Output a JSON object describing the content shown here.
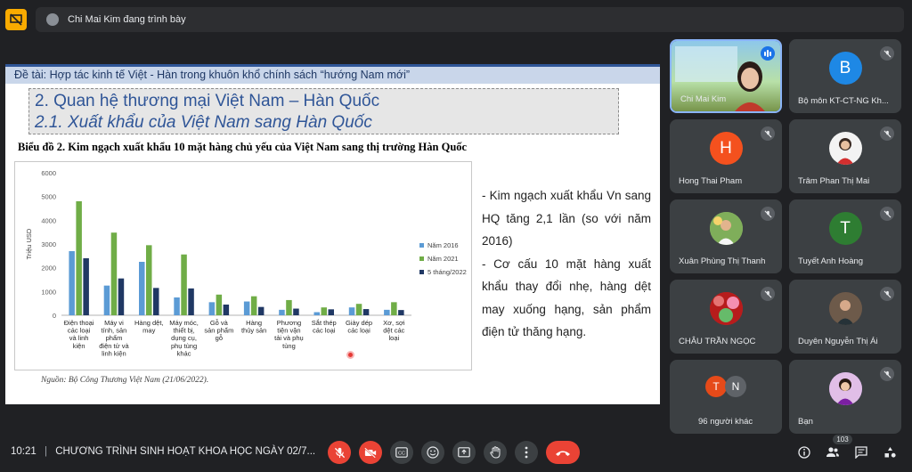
{
  "top_bar": {
    "presenter_text": "Chi Mai Kim đang trình bày"
  },
  "slide": {
    "topic": "Đề tài: Hợp tác kinh tế  Việt - Hàn trong khuôn khổ chính sách “hướng Nam mới”",
    "heading1": "2. Quan hệ thương mại Việt Nam – Hàn Quốc",
    "heading2": "2.1. Xuất khẩu của Việt Nam sang Hàn Quốc",
    "chart_title": "Biểu đồ 2. Kim ngạch xuất khẩu 10 mặt hàng chủ yếu của Việt Nam sang thị trường Hàn Quốc",
    "source": "Nguồn: Bộ Công Thương Việt Nam (21/06/2022).",
    "bullet1": "- Kim ngạch xuất khẩu Vn sang HQ tăng 2,1 lần (so với năm 2016)",
    "bullet2": "-  Cơ cấu 10 mặt hàng xuất khẩu thay đổi nhẹ, hàng dệt may xuống hạng, sản phẩm điện tử thăng hạng."
  },
  "chart_data": {
    "type": "bar",
    "ylabel": "Triệu USD",
    "ylim": [
      0,
      6000
    ],
    "yticks": [
      0,
      1000,
      2000,
      3000,
      4000,
      5000,
      6000
    ],
    "legend_position": "right",
    "categories": [
      [
        "Điện thoại",
        "các loại",
        "và linh",
        "kiện"
      ],
      [
        "Máy vi",
        "tính, sản",
        "phẩm",
        "điện tử và",
        "linh kiện"
      ],
      [
        "Hàng dệt,",
        "may"
      ],
      [
        "Máy móc,",
        "thiết bị,",
        "dụng cụ,",
        "phụ tùng",
        "khác"
      ],
      [
        "Gỗ và",
        "sản phẩm",
        "gỗ"
      ],
      [
        "Hàng",
        "thủy sản"
      ],
      [
        "Phương",
        "tiện vận",
        "tải và phụ",
        "tùng"
      ],
      [
        "Sắt thép",
        "các loại"
      ],
      [
        "Giày dép",
        "các loại"
      ],
      [
        "Xơ, sợi",
        "dệt các",
        "loại"
      ]
    ],
    "series": [
      {
        "name": "Năm 2016",
        "color": "#5b9bd5",
        "values": [
          2700,
          1250,
          2250,
          750,
          550,
          580,
          230,
          130,
          330,
          230
        ]
      },
      {
        "name": "Năm 2021",
        "color": "#70ad47",
        "values": [
          4800,
          3480,
          2950,
          2560,
          870,
          800,
          640,
          330,
          480,
          550
        ]
      },
      {
        "name": "5 tháng/2022",
        "color": "#203864",
        "values": [
          2400,
          1550,
          1150,
          1130,
          450,
          350,
          280,
          250,
          260,
          220
        ]
      }
    ]
  },
  "participants": [
    {
      "name": "Chi Mai Kim",
      "type": "video",
      "speaking": true
    },
    {
      "name": "Bộ môn KT-CT-NG Kh...",
      "initial": "B",
      "color": "#1e88e5",
      "type": "avatar"
    },
    {
      "name": "Hong Thai Pham",
      "initial": "H",
      "color": "#f4511e",
      "type": "avatar"
    },
    {
      "name": "Trâm Phan Thị Mai",
      "type": "photo"
    },
    {
      "name": "Xuân Phùng Thị Thanh",
      "type": "photo"
    },
    {
      "name": "Tuyết Anh Hoàng",
      "initial": "T",
      "color": "#2e7d32",
      "type": "avatar"
    },
    {
      "name": "CHÂU TRẦN NGỌC",
      "type": "photo"
    },
    {
      "name": "Duyên Nguyễn Thị Ái",
      "type": "photo"
    },
    {
      "name": "96 người khác",
      "type": "group",
      "initials": [
        "T",
        "N"
      ]
    },
    {
      "name": "Bạn",
      "type": "photo"
    }
  ],
  "bottom_bar": {
    "time": "10:21",
    "separator": "|",
    "meeting_title": "CHƯƠNG TRÌNH SINH HOẠT KHOA HỌC NGÀY 02/7...",
    "participant_count": "103"
  }
}
